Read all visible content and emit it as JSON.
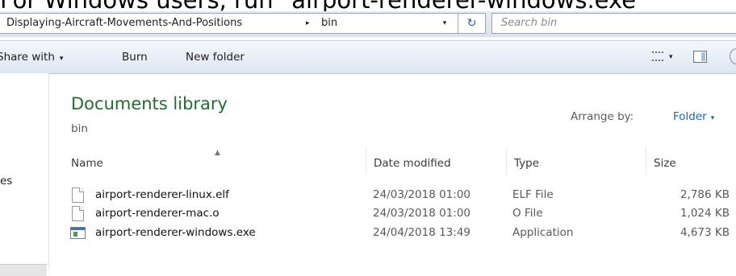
{
  "caption": "For Windows users, run \"airport-renderer-windows.exe\"",
  "address_bar": {
    "path_segment": "Displaying-Aircraft-Movements-And-Positions",
    "separator": "▸",
    "current": "bin",
    "dropdown": "▾",
    "refresh": "↻",
    "search_placeholder": "Search bin"
  },
  "toolbar": {
    "share_label": "Share with",
    "burn_label": "Burn",
    "new_folder_label": "New folder",
    "dropdown": "▾"
  },
  "nav": {
    "partial_label": "es"
  },
  "library": {
    "title": "Documents library",
    "subtitle": "bin",
    "arrange_label": "Arrange by:",
    "arrange_value": "Folder"
  },
  "columns": {
    "name": "Name",
    "date": "Date modified",
    "type": "Type",
    "size": "Size",
    "sort_indicator": "▲"
  },
  "files": [
    {
      "name": "airport-renderer-linux.elf",
      "date": "24/03/2018 01:00",
      "type": "ELF File",
      "size": "2,786 KB",
      "icon": "document-icon"
    },
    {
      "name": "airport-renderer-mac.o",
      "date": "24/03/2018 01:00",
      "type": "O File",
      "size": "1,024 KB",
      "icon": "document-icon"
    },
    {
      "name": "airport-renderer-windows.exe",
      "date": "24/04/2018 13:49",
      "type": "Application",
      "size": "4,673 KB",
      "icon": "application-icon"
    }
  ]
}
